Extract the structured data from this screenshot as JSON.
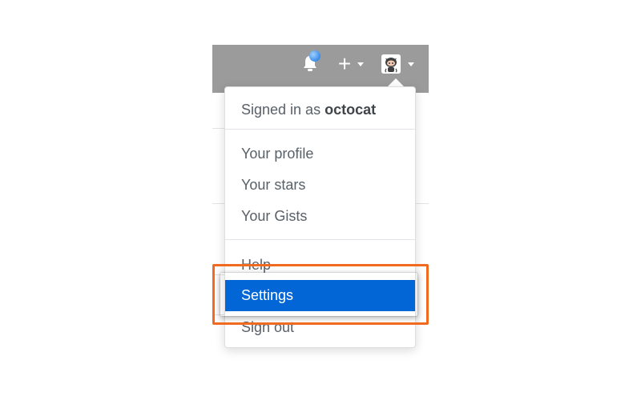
{
  "header": {
    "icons": [
      "bell-icon",
      "plus-icon",
      "avatar-icon"
    ],
    "notification_dot_color": "#3b8ce8"
  },
  "menu": {
    "signed_in_prefix": "Signed in as",
    "username": "octocat",
    "items": {
      "profile": "Your profile",
      "stars": "Your stars",
      "gists": "Your Gists",
      "help": "Help",
      "settings": "Settings",
      "sign_out": "Sign out"
    },
    "selected_item": "Settings",
    "selected_color": "#0366d6"
  },
  "annotation": {
    "highlight_color": "#f06a1f"
  }
}
